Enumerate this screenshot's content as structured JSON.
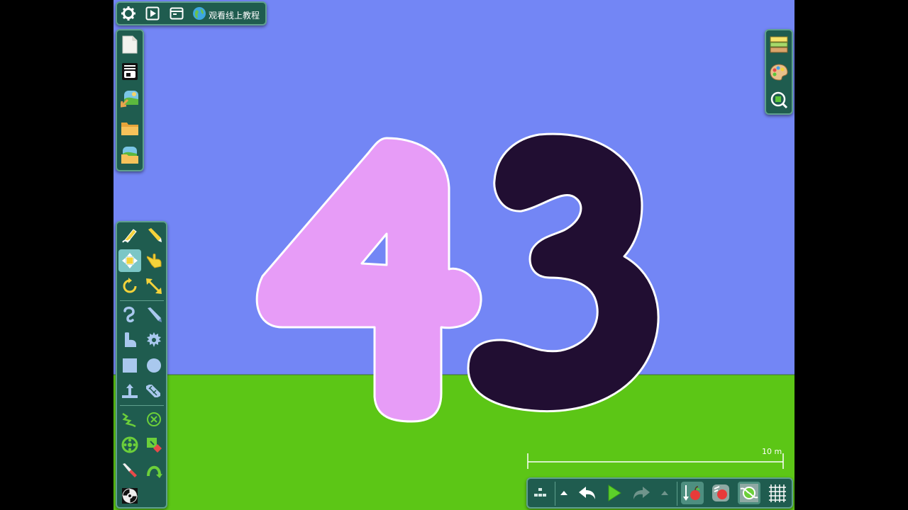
{
  "top_bar": {
    "settings_icon": "gear-icon",
    "play_icon": "play-icon",
    "window_icon": "window-icon",
    "tutorial_icon": "globe-icon",
    "tutorial_label": "观看线上教程"
  },
  "file_toolbar": {
    "items": [
      "new-file-icon",
      "template-icon",
      "import-image-icon",
      "open-folder-icon",
      "online-levels-icon"
    ]
  },
  "right_toolbar": {
    "items": [
      "layers-icon",
      "palette-icon",
      "zoom-icon"
    ]
  },
  "tool_palette": {
    "selected": "move-tool",
    "items": [
      "draw-tool",
      "sketch-tool",
      "move-tool",
      "drag-tool",
      "rotate-tool",
      "scale-tool",
      "rope-tool",
      "cut-tool",
      "deform-tool",
      "gear-tool",
      "box-tool",
      "circle-tool",
      "piston-tool",
      "chain-tool",
      "spring-tool",
      "delete-tool",
      "wheel-tool",
      "eraser-tool",
      "knife-tool",
      "hinge-tool",
      "vortex-tool"
    ]
  },
  "canvas": {
    "digits": [
      "4",
      "3"
    ],
    "digit_colors": [
      "#e79cf7",
      "#210e32"
    ],
    "sky_color": "#7386f5",
    "ground_color": "#5cc616"
  },
  "scale_bar": {
    "label": "10 m"
  },
  "bottom_bar": {
    "items": [
      "grid-snap-icon",
      "up-arrow-icon",
      "undo-icon",
      "play-button-icon",
      "redo-icon",
      "up-arrow-icon",
      "gravity-icon",
      "physics-icon",
      "collision-icon",
      "grid-icon"
    ]
  }
}
